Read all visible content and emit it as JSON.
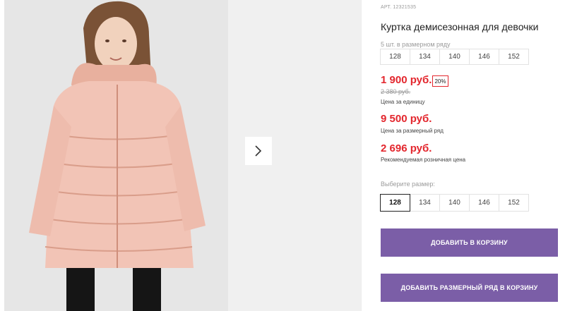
{
  "product": {
    "sku": "АРТ. 12321535",
    "title": "Куртка демисезонная для девочки",
    "series_label": "5 шт. в размерном ряду",
    "series_sizes": [
      "128",
      "134",
      "140",
      "146",
      "152"
    ]
  },
  "pricing": {
    "unit_price": "1 900 руб.",
    "discount": "20%",
    "old_price": "2 380 руб.",
    "unit_label": "Цена за единицу",
    "series_price": "9 500 руб.",
    "series_label": "Цена за размерный ряд",
    "retail_price": "2 696 руб.",
    "retail_label": "Рекомендуемая розничная цена"
  },
  "size_picker": {
    "label": "Выберите размер:",
    "options": [
      "128",
      "134",
      "140",
      "146",
      "152"
    ],
    "selected": "128"
  },
  "actions": {
    "add_to_cart": "ДОБАВИТЬ В КОРЗИНУ",
    "add_series_to_cart": "ДОБАВИТЬ РАЗМЕРНЫЙ РЯД В КОРЗИНУ"
  },
  "colors": {
    "price_red": "#e3262d",
    "button_purple": "#7b5ea7",
    "jacket_pink": "#f2c4b6"
  },
  "gallery": {
    "image_subject": "girl in pink puffer jacket",
    "next_icon": "chevron-right-icon"
  }
}
